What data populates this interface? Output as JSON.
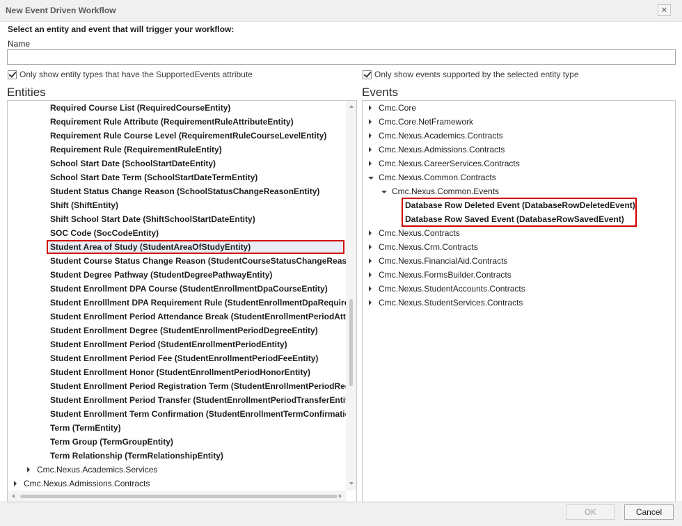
{
  "window": {
    "title": "New Event Driven Workflow",
    "close_glyph": "✕"
  },
  "heading": "Select an entity and event that will trigger your workflow:",
  "name_field": {
    "label": "Name",
    "value": ""
  },
  "entity_filter": {
    "label": "Only show entity types that have the SupportedEvents attribute",
    "checked": true
  },
  "event_filter": {
    "label": "Only show events supported by the selected entity type",
    "checked": true
  },
  "entities": {
    "title": "Entities",
    "items": [
      {
        "label": "Required Course List (RequiredCourseEntity)",
        "level": 2,
        "bold": true
      },
      {
        "label": "Requirement Rule Attribute (RequirementRuleAttributeEntity)",
        "level": 2,
        "bold": true
      },
      {
        "label": "Requirement Rule Course Level (RequirementRuleCourseLevelEntity)",
        "level": 2,
        "bold": true
      },
      {
        "label": "Requirement Rule (RequirementRuleEntity)",
        "level": 2,
        "bold": true
      },
      {
        "label": "School Start Date (SchoolStartDateEntity)",
        "level": 2,
        "bold": true
      },
      {
        "label": "School Start Date Term (SchoolStartDateTermEntity)",
        "level": 2,
        "bold": true
      },
      {
        "label": "Student Status Change Reason (SchoolStatusChangeReasonEntity)",
        "level": 2,
        "bold": true
      },
      {
        "label": "Shift (ShiftEntity)",
        "level": 2,
        "bold": true
      },
      {
        "label": "Shift School Start Date (ShiftSchoolStartDateEntity)",
        "level": 2,
        "bold": true
      },
      {
        "label": "SOC Code (SocCodeEntity)",
        "level": 2,
        "bold": true
      },
      {
        "label": "Student Area of Study (StudentAreaOfStudyEntity)",
        "level": 2,
        "bold": true,
        "selected": true
      },
      {
        "label": "Student Course Status Change Reason (StudentCourseStatusChangeReasonEntity)",
        "level": 2,
        "bold": true
      },
      {
        "label": "Student Degree Pathway (StudentDegreePathwayEntity)",
        "level": 2,
        "bold": true
      },
      {
        "label": "Student Enrollment DPA Course (StudentEnrollmentDpaCourseEntity)",
        "level": 2,
        "bold": true
      },
      {
        "label": "Student Enrolllment DPA Requirement Rule (StudentEnrollmentDpaRequirementRuleEntity)",
        "level": 2,
        "bold": true
      },
      {
        "label": "Student Enrollment Period Attendance Break (StudentEnrollmentPeriodAttendanceBreakEntity)",
        "level": 2,
        "bold": true
      },
      {
        "label": "Student Enrollment Degree (StudentEnrollmentPeriodDegreeEntity)",
        "level": 2,
        "bold": true
      },
      {
        "label": "Student Enrollment Period (StudentEnrollmentPeriodEntity)",
        "level": 2,
        "bold": true
      },
      {
        "label": "Student Enrollment Period Fee (StudentEnrollmentPeriodFeeEntity)",
        "level": 2,
        "bold": true
      },
      {
        "label": "Student Enrollment Honor (StudentEnrollmentPeriodHonorEntity)",
        "level": 2,
        "bold": true
      },
      {
        "label": "Student Enrollment Period Registration Term (StudentEnrollmentPeriodRegistrationTermEntity)",
        "level": 2,
        "bold": true
      },
      {
        "label": "Student Enrollment Period Transfer (StudentEnrollmentPeriodTransferEntity)",
        "level": 2,
        "bold": true
      },
      {
        "label": "Student Enrollment Term Confirmation (StudentEnrollmentTermConfirmationEntity)",
        "level": 2,
        "bold": true
      },
      {
        "label": "Term (TermEntity)",
        "level": 2,
        "bold": true
      },
      {
        "label": "Term Group (TermGroupEntity)",
        "level": 2,
        "bold": true
      },
      {
        "label": "Term Relationship (TermRelationshipEntity)",
        "level": 2,
        "bold": true
      },
      {
        "label": "Cmc.Nexus.Academics.Services",
        "level": 1,
        "bold": false,
        "expander": "collapsed"
      },
      {
        "label": "Cmc.Nexus.Admissions.Contracts",
        "level": 0,
        "bold": false,
        "expander": "collapsed"
      }
    ]
  },
  "events": {
    "title": "Events",
    "items": [
      {
        "label": "Cmc.Core",
        "level": 0,
        "bold": false,
        "expander": "collapsed"
      },
      {
        "label": "Cmc.Core.NetFramework",
        "level": 0,
        "bold": false,
        "expander": "collapsed"
      },
      {
        "label": "Cmc.Nexus.Academics.Contracts",
        "level": 0,
        "bold": false,
        "expander": "collapsed"
      },
      {
        "label": "Cmc.Nexus.Admissions.Contracts",
        "level": 0,
        "bold": false,
        "expander": "collapsed"
      },
      {
        "label": "Cmc.Nexus.CareerServices.Contracts",
        "level": 0,
        "bold": false,
        "expander": "collapsed"
      },
      {
        "label": "Cmc.Nexus.Common.Contracts",
        "level": 0,
        "bold": false,
        "expander": "expanded"
      },
      {
        "label": "Cmc.Nexus.Common.Events",
        "level": 1,
        "bold": false,
        "expander": "expanded"
      },
      {
        "label": "Database Row Deleted Event (DatabaseRowDeletedEvent)",
        "level": 2,
        "bold": true,
        "highlighted": true
      },
      {
        "label": "Database Row Saved Event (DatabaseRowSavedEvent)",
        "level": 2,
        "bold": true,
        "highlighted": true
      },
      {
        "label": "Cmc.Nexus.Contracts",
        "level": 0,
        "bold": false,
        "expander": "collapsed"
      },
      {
        "label": "Cmc.Nexus.Crm.Contracts",
        "level": 0,
        "bold": false,
        "expander": "collapsed"
      },
      {
        "label": "Cmc.Nexus.FinancialAid.Contracts",
        "level": 0,
        "bold": false,
        "expander": "collapsed"
      },
      {
        "label": "Cmc.Nexus.FormsBuilder.Contracts",
        "level": 0,
        "bold": false,
        "expander": "collapsed"
      },
      {
        "label": "Cmc.Nexus.StudentAccounts.Contracts",
        "level": 0,
        "bold": false,
        "expander": "collapsed"
      },
      {
        "label": "Cmc.Nexus.StudentServices.Contracts",
        "level": 0,
        "bold": false,
        "expander": "collapsed"
      }
    ]
  },
  "footer": {
    "ok_label": "OK",
    "cancel_label": "Cancel",
    "ok_enabled": false
  },
  "colors": {
    "highlight_border": "#d00000",
    "panel_border": "#c8c8c8"
  }
}
